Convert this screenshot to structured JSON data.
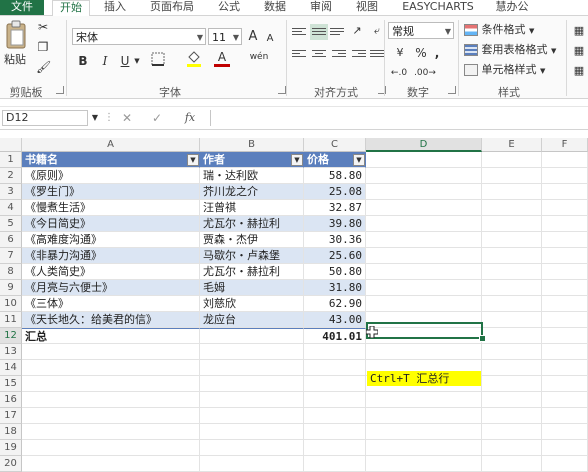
{
  "tabs": [
    "文件",
    "开始",
    "插入",
    "页面布局",
    "公式",
    "数据",
    "审阅",
    "视图",
    "EASYCHARTS",
    "慧办公"
  ],
  "active_tab": "开始",
  "ribbon": {
    "clipboard": {
      "paste": "粘贴",
      "label": "剪贴板"
    },
    "font": {
      "name": "宋体",
      "size": "11",
      "grow": "A",
      "shrink": "A",
      "bold": "B",
      "italic": "I",
      "underline": "U",
      "wen": "wén",
      "color_a": "A",
      "label": "字体",
      "fill_color": "#ffff00",
      "font_color": "#c00000"
    },
    "align": {
      "label": "对齐方式"
    },
    "number": {
      "format": "常规",
      "percent": "%",
      "comma": ",",
      "label": "数字"
    },
    "styles": {
      "cond": "条件格式",
      "table": "套用表格格式",
      "cell": "单元格样式",
      "label": "样式"
    }
  },
  "formula_bar": {
    "name_box": "D12",
    "fx": "fx",
    "content": ""
  },
  "columns": [
    "A",
    "B",
    "C",
    "D",
    "E",
    "F"
  ],
  "rows": [
    "1",
    "2",
    "3",
    "4",
    "5",
    "6",
    "7",
    "8",
    "9",
    "10",
    "11",
    "12",
    "13",
    "14",
    "15",
    "16",
    "17",
    "18",
    "19",
    "20"
  ],
  "table": {
    "headers": [
      "书籍名",
      "作者",
      "价格"
    ],
    "rows": [
      [
        "《原则》",
        "瑞・达利欧",
        "58.80"
      ],
      [
        "《罗生门》",
        "芥川龙之介",
        "25.08"
      ],
      [
        "《慢煮生活》",
        "汪曾祺",
        "32.87"
      ],
      [
        "《今日简史》",
        "尤瓦尔・赫拉利",
        "39.80"
      ],
      [
        "《高难度沟通》",
        "贾森・杰伊",
        "30.36"
      ],
      [
        "《非暴力沟通》",
        "马歇尔・卢森堡",
        "25.60"
      ],
      [
        "《人类简史》",
        "尤瓦尔・赫拉利",
        "50.80"
      ],
      [
        "《月亮与六便士》",
        "毛姆",
        "31.80"
      ],
      [
        "《三体》",
        "刘慈欣",
        "62.90"
      ],
      [
        "《天长地久：给美君的信》",
        "龙应台",
        "43.00"
      ]
    ],
    "total_label": "汇总",
    "total_value": "401.01",
    "header_color": "#5b7fbd",
    "band_color": "#dbe5f3"
  },
  "note": {
    "text": "Ctrl+T 汇总行",
    "color": "#ffff00"
  },
  "accent": "#217346"
}
